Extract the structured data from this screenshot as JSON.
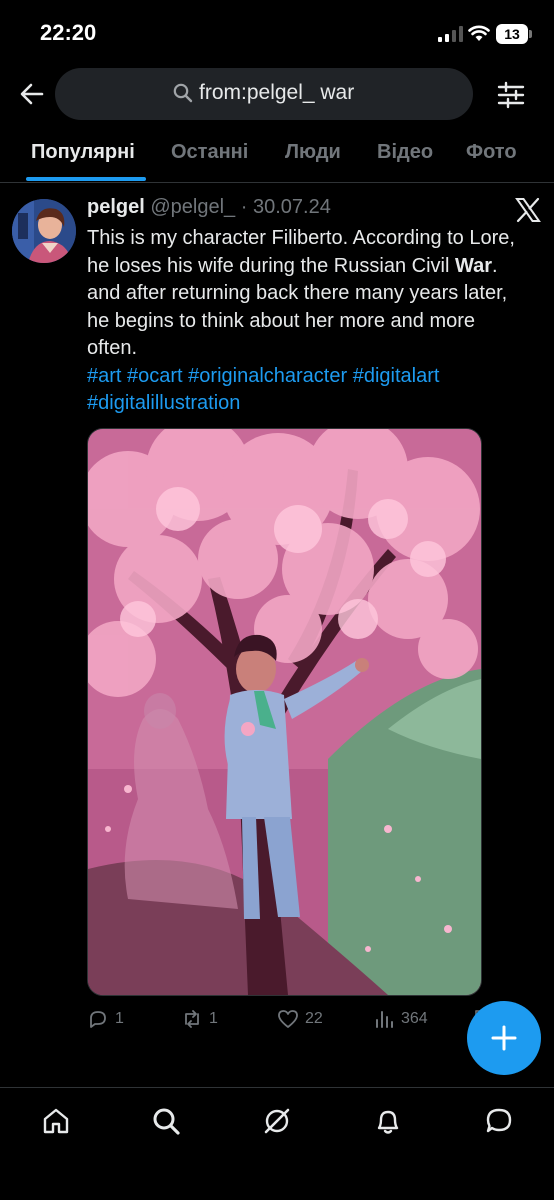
{
  "status_bar": {
    "time": "22:20",
    "battery_level": "13"
  },
  "search": {
    "query": "from:pelgel_ war"
  },
  "tabs": [
    {
      "label": "Популярні",
      "active": true
    },
    {
      "label": "Останні"
    },
    {
      "label": "Люди"
    },
    {
      "label": "Відео"
    },
    {
      "label": "Фото"
    }
  ],
  "post": {
    "display_name": "pelgel",
    "handle": "@pelgel_",
    "separator": "·",
    "date": "30.07.24",
    "text_before": "This is my character Filiberto. According to Lore, he loses his wife during the Russian Civil ",
    "text_bold": "War",
    "text_after": ". and after returning back there many years later, he begins to think about her more and more often.",
    "hashtags": "#art #ocart #originalcharacter #digitalart #digitalillustration",
    "image_description": "painting of a man in a pale blue suit leaning against a pink blossoming tree, a translucent woman in a dress beside him",
    "replies": "1",
    "reposts": "1",
    "likes": "22",
    "views": "364"
  },
  "icons": {
    "back": "arrow-left-icon",
    "search": "search-icon",
    "filter": "sliders-icon",
    "platform": "x-logo-icon",
    "compose": "plus-icon",
    "nav": [
      "home-icon",
      "search-icon",
      "grok-icon",
      "bell-icon",
      "message-icon"
    ]
  },
  "colors": {
    "accent": "#1d9bf0",
    "background": "#000000",
    "muted": "#71767b"
  }
}
